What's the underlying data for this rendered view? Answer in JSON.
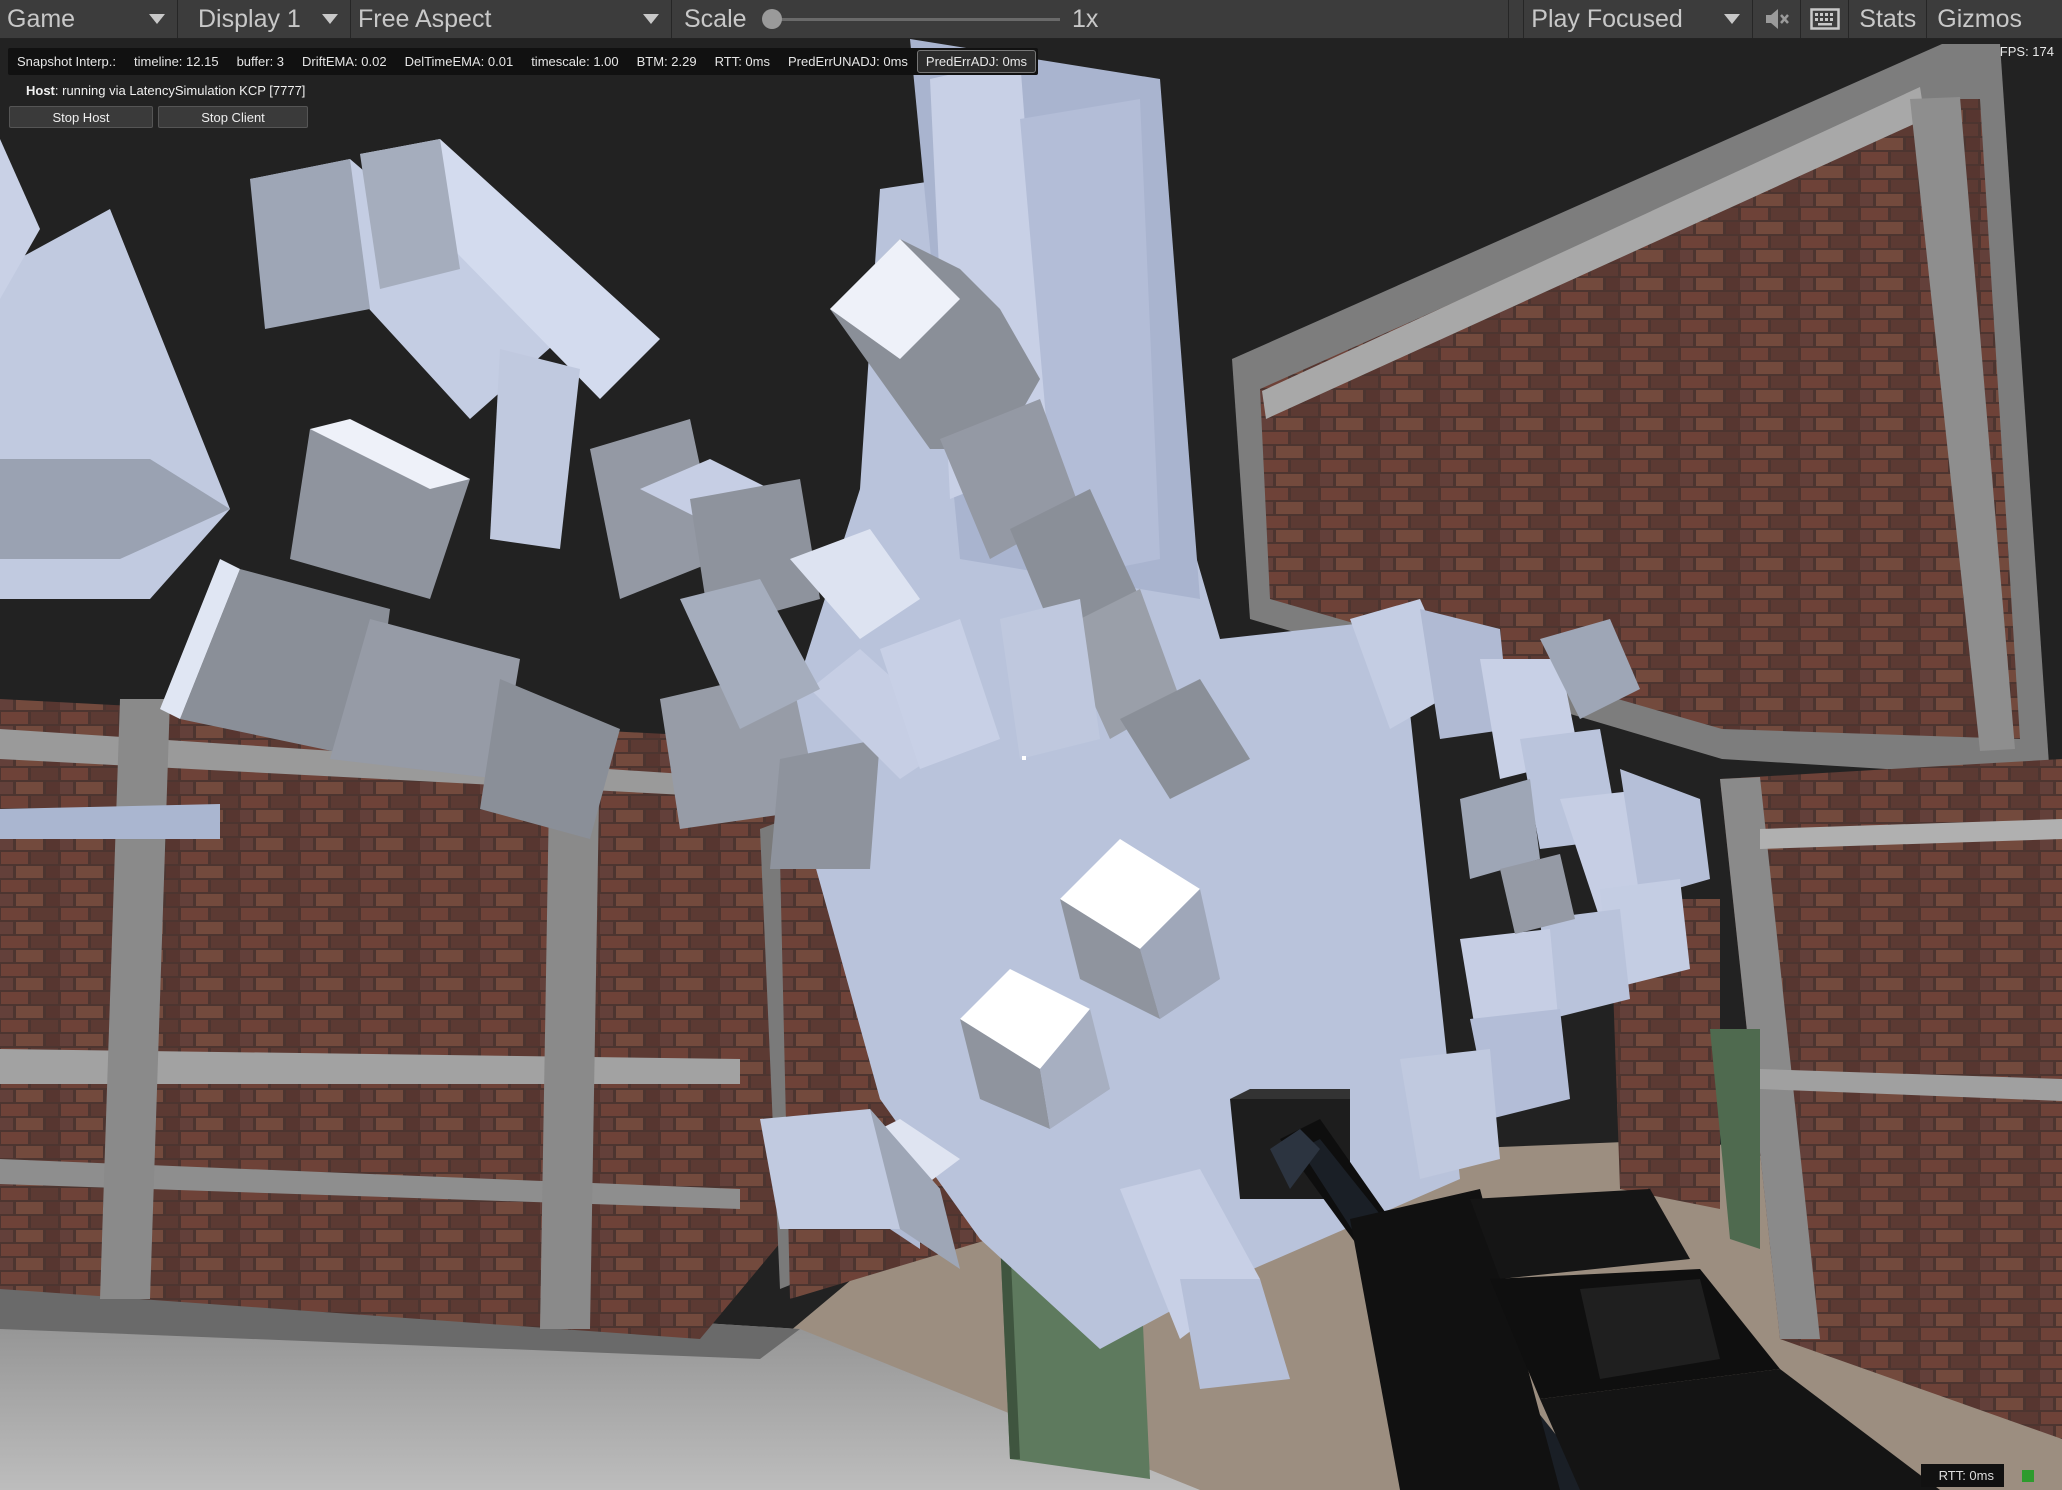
{
  "toolbar": {
    "game_tab": "Game",
    "display": "Display 1",
    "aspect": "Free Aspect",
    "scale_label": "Scale",
    "scale_value": "1x",
    "play_mode": "Play Focused",
    "stats": "Stats",
    "gizmos": "Gizmos",
    "mute_icon": "audio-mute-icon",
    "keyboard_icon": "keyboard-icon"
  },
  "hud": {
    "snapshot": "Snapshot Interp.:",
    "timeline": "timeline: 12.15",
    "buffer": "buffer: 3",
    "drift": "DriftEMA: 0.02",
    "deltime": "DelTimeEMA: 0.01",
    "timescale": "timescale: 1.00",
    "btm": "BTM: 2.29",
    "rtt": "RTT: 0ms",
    "pred_unadj": "PredErrUNADJ: 0ms",
    "pred_adj": "PredErrADJ: 0ms",
    "host_label": "Host",
    "host_status": ": running via LatencySimulation KCP [7777]",
    "stop_host": "Stop Host",
    "stop_client": "Stop Client",
    "fps": "FPS: 174",
    "rtt_corner": "RTT: 0ms"
  },
  "colors": {
    "toolbar_bg": "#3c3c3c",
    "cube": "#b8c4e0",
    "brick": "#5a3a30",
    "concrete": "#9a9a9a"
  }
}
